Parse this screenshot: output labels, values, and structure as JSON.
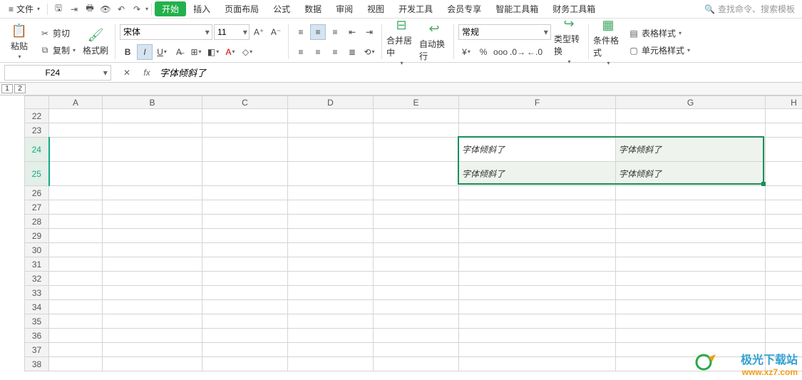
{
  "menu": {
    "file": "文件",
    "tabs": [
      "开始",
      "插入",
      "页面布局",
      "公式",
      "数据",
      "审阅",
      "视图",
      "开发工具",
      "会员专享",
      "智能工具箱",
      "财务工具箱"
    ],
    "activeTab": 0,
    "searchPlaceholder": "查找命令、搜索模板"
  },
  "ribbon": {
    "paste": "粘贴",
    "cut": "剪切",
    "copy": "复制",
    "formatPainter": "格式刷",
    "fontName": "宋体",
    "fontSize": "11",
    "mergeCenter": "合并居中",
    "autoWrap": "自动换行",
    "numberFormat": "常规",
    "typeConvert": "类型转换",
    "condFormat": "条件格式",
    "tableStyle": "表格样式",
    "cellStyle": "单元格样式"
  },
  "nameBox": "F24",
  "formula": "字体倾斜了",
  "outline": [
    "1",
    "2"
  ],
  "columns": [
    "A",
    "B",
    "C",
    "D",
    "E",
    "F",
    "G",
    "H"
  ],
  "rows": [
    {
      "n": 22,
      "sel": false,
      "cells": [
        "",
        "",
        "",
        "",
        "",
        "",
        "",
        ""
      ]
    },
    {
      "n": 23,
      "sel": false,
      "cells": [
        "",
        "",
        "",
        "",
        "",
        "",
        "",
        ""
      ]
    },
    {
      "n": 24,
      "sel": true,
      "cells": [
        "",
        "",
        "",
        "",
        "",
        "字体倾斜了",
        "字体倾斜了",
        ""
      ]
    },
    {
      "n": 25,
      "sel": true,
      "cells": [
        "",
        "",
        "",
        "",
        "",
        "字体倾斜了",
        "字体倾斜了",
        ""
      ]
    },
    {
      "n": 26,
      "sel": false,
      "cells": [
        "",
        "",
        "",
        "",
        "",
        "",
        "",
        ""
      ]
    },
    {
      "n": 27,
      "sel": false,
      "cells": [
        "",
        "",
        "",
        "",
        "",
        "",
        "",
        ""
      ]
    },
    {
      "n": 28,
      "sel": false,
      "cells": [
        "",
        "",
        "",
        "",
        "",
        "",
        "",
        ""
      ]
    },
    {
      "n": 29,
      "sel": false,
      "cells": [
        "",
        "",
        "",
        "",
        "",
        "",
        "",
        ""
      ]
    },
    {
      "n": 30,
      "sel": false,
      "cells": [
        "",
        "",
        "",
        "",
        "",
        "",
        "",
        ""
      ]
    },
    {
      "n": 31,
      "sel": false,
      "cells": [
        "",
        "",
        "",
        "",
        "",
        "",
        "",
        ""
      ]
    },
    {
      "n": 32,
      "sel": false,
      "cells": [
        "",
        "",
        "",
        "",
        "",
        "",
        "",
        ""
      ]
    },
    {
      "n": 33,
      "sel": false,
      "cells": [
        "",
        "",
        "",
        "",
        "",
        "",
        "",
        ""
      ]
    },
    {
      "n": 34,
      "sel": false,
      "cells": [
        "",
        "",
        "",
        "",
        "",
        "",
        "",
        ""
      ]
    },
    {
      "n": 35,
      "sel": false,
      "cells": [
        "",
        "",
        "",
        "",
        "",
        "",
        "",
        ""
      ]
    },
    {
      "n": 36,
      "sel": false,
      "cells": [
        "",
        "",
        "",
        "",
        "",
        "",
        "",
        ""
      ]
    },
    {
      "n": 37,
      "sel": false,
      "cells": [
        "",
        "",
        "",
        "",
        "",
        "",
        "",
        ""
      ]
    },
    {
      "n": 38,
      "sel": false,
      "cells": [
        "",
        "",
        "",
        "",
        "",
        "",
        "",
        ""
      ]
    }
  ],
  "selection": {
    "colStart": 5,
    "colEnd": 6,
    "rowStart": 2,
    "rowEnd": 3
  },
  "watermark": {
    "zh": "极光下载站",
    "url": "www.xz7.com"
  }
}
